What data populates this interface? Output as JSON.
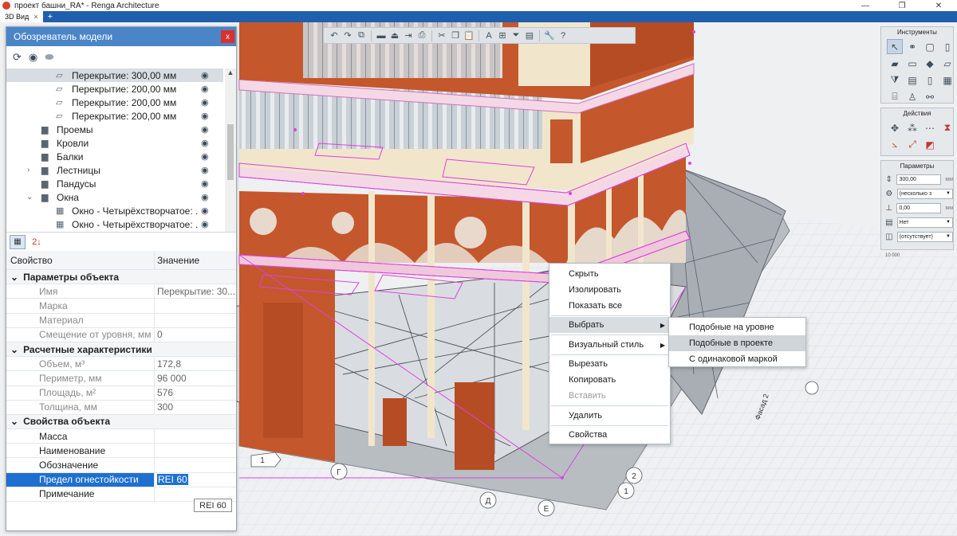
{
  "window": {
    "title": "проект башни_RA* - Renga Architecture",
    "controls": [
      "—",
      "❐",
      "✕"
    ]
  },
  "tabs": [
    {
      "label": "3D Вид",
      "close": "×"
    }
  ],
  "tab_add": "+",
  "toolbar": {
    "icons": [
      "undo-icon",
      "redo-icon",
      "copy-icon",
      "cut-paste-icon",
      "bucket-icon",
      "level-icon",
      "export-icon",
      "print-icon",
      "scissors-icon",
      "copy-doc-icon",
      "paste-icon",
      "text-icon",
      "tag-icon",
      "filter-icon",
      "view-icon",
      "wrench-icon",
      "help-icon"
    ]
  },
  "model_browser": {
    "title": "Обозреватель модели",
    "close": "x",
    "tree": [
      {
        "label": "Перекрытие: 300,00 мм",
        "level": 3,
        "icon": "slab-icon",
        "selected": true
      },
      {
        "label": "Перекрытие: 200,00 мм",
        "level": 3,
        "icon": "slab-icon"
      },
      {
        "label": "Перекрытие: 200,00 мм",
        "level": 3,
        "icon": "slab-icon"
      },
      {
        "label": "Перекрытие: 200,00 мм",
        "level": 3,
        "icon": "slab-icon"
      },
      {
        "label": "Проемы",
        "level": 2,
        "icon": "folder-icon"
      },
      {
        "label": "Кровли",
        "level": 2,
        "icon": "folder-icon"
      },
      {
        "label": "Балки",
        "level": 2,
        "icon": "folder-icon"
      },
      {
        "label": "Лестницы",
        "level": 2,
        "icon": "folder-icon",
        "expand": "›"
      },
      {
        "label": "Пандусы",
        "level": 2,
        "icon": "folder-icon"
      },
      {
        "label": "Окна",
        "level": 2,
        "icon": "folder-icon",
        "expand": "⌄"
      },
      {
        "label": "Окно - Четырёхстворчатое: ...",
        "level": 3,
        "icon": "window-icon"
      },
      {
        "label": "Окно - Четырёхстворчатое: ...",
        "level": 3,
        "icon": "window-icon"
      }
    ],
    "properties": {
      "col_property": "Свойство",
      "col_value": "Значение",
      "groups": [
        {
          "name": "Параметры объекта",
          "rows": [
            {
              "name": "Имя",
              "value": "Перекрытие: 30..."
            },
            {
              "name": "Марка",
              "value": ""
            },
            {
              "name": "Материал",
              "value": ""
            },
            {
              "name": "Смещение от уровня, мм",
              "value": "0"
            }
          ]
        },
        {
          "name": "Расчетные характеристики",
          "rows": [
            {
              "name": "Объем, м³",
              "value": "172,8"
            },
            {
              "name": "Периметр, мм",
              "value": "96 000"
            },
            {
              "name": "Площадь, м²",
              "value": "576"
            },
            {
              "name": "Толщина, мм",
              "value": "300"
            }
          ]
        },
        {
          "name": "Свойства объекта",
          "rows": [
            {
              "name": "Масса",
              "value": "",
              "dark": true
            },
            {
              "name": "Наименование",
              "value": "",
              "dark": true
            },
            {
              "name": "Обозначение",
              "value": "",
              "dark": true
            },
            {
              "name": "Предел огнестойкости",
              "value": "REI 60",
              "dark": true,
              "selected": true
            },
            {
              "name": "Примечание",
              "value": "",
              "dark": true
            }
          ]
        }
      ]
    },
    "tooltip": "REI 60"
  },
  "right_panels": {
    "tools_title": "Инструменты",
    "actions_title": "Действия",
    "params_title": "Параметры",
    "params": [
      {
        "value": "300,00",
        "unit": "мм",
        "dropdown": false
      },
      {
        "value": "(несколько з",
        "unit": "",
        "dropdown": true
      },
      {
        "value": "0,00",
        "unit": "мм",
        "dropdown": false
      },
      {
        "value": "Нет",
        "unit": "",
        "dropdown": true
      },
      {
        "value": "(отсутствует)",
        "unit": "",
        "dropdown": true
      }
    ]
  },
  "context_menu": {
    "items": [
      "Скрыть",
      "Изолировать",
      "Показать все",
      "Выбрать",
      "Визуальный стиль",
      "Вырезать",
      "Копировать",
      "Вставить",
      "Удалить",
      "Свойства"
    ],
    "submenu_arrow": "▶",
    "submenu": [
      "Подобные на уровне",
      "Подобные в проекте",
      "С одинаковой маркой"
    ]
  },
  "grid_labels": [
    "1",
    "2",
    "1",
    "Г",
    "Д",
    "Е",
    "Фасад 2",
    "Фаса",
    "10 000"
  ],
  "colors": {
    "brick": "#c4572b",
    "cream": "#f1e6cc",
    "accent": "#1e6fd0",
    "panel_header": "#4a86c7",
    "selection": "#e040e0"
  }
}
